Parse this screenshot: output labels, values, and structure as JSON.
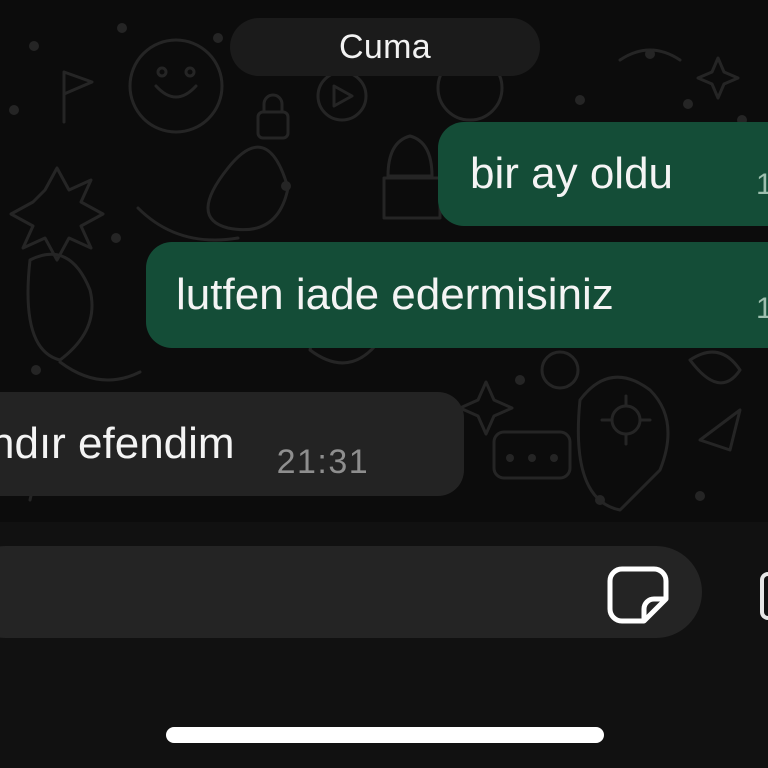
{
  "chat": {
    "date_separator": "Cuma",
    "messages": [
      {
        "direction": "outgoing",
        "text": "bir ay oldu",
        "time_visible": "1"
      },
      {
        "direction": "outgoing",
        "text": "lutfen iade edermisiniz",
        "time_visible": "1"
      },
      {
        "direction": "incoming",
        "text": "ndır efendim",
        "time": "21:31"
      }
    ]
  },
  "composer": {
    "input_value": "",
    "icons": [
      "sticker-icon",
      "camera-icon"
    ]
  },
  "theme": {
    "background": "#0b0b0b",
    "outgoing_bubble": "#144d37",
    "incoming_bubble": "#232323",
    "input_field": "#242424",
    "date_pill": "#1b1b1b"
  }
}
